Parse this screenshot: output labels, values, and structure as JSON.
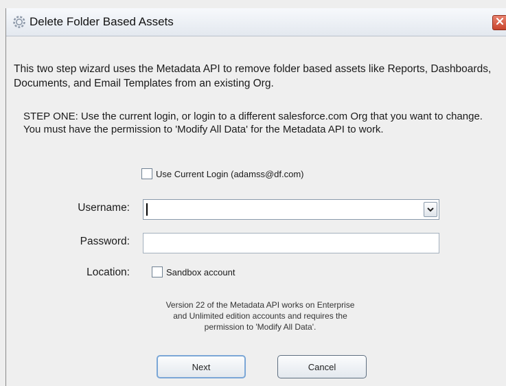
{
  "window": {
    "title": "Delete Folder Based Assets",
    "title_icon": "gear-icon",
    "close_icon": "close-icon"
  },
  "intro_text": "This two step wizard uses the Metadata API to remove folder based assets like Reports, Dashboards, Documents, and Email Templates from an existing Org.",
  "step_one_text": "STEP ONE: Use the current login, or login to a different salesforce.com Org that you want to change. You must have the permission to 'Modify All Data' for the Metadata API to work.",
  "use_current_login": {
    "label": "Use Current Login (adamss@df.com)",
    "checked": false
  },
  "username": {
    "label": "Username:",
    "value": ""
  },
  "password": {
    "label": "Password:",
    "value": ""
  },
  "location": {
    "label": "Location:",
    "sandbox_label": "Sandbox account",
    "checked": false
  },
  "note": {
    "line1": "Version 22 of the Metadata API works on Enterprise",
    "line2": "and Unlimited edition accounts and requires the",
    "line3": "permission to 'Modify All Data'."
  },
  "buttons": {
    "next": "Next",
    "cancel": "Cancel"
  }
}
